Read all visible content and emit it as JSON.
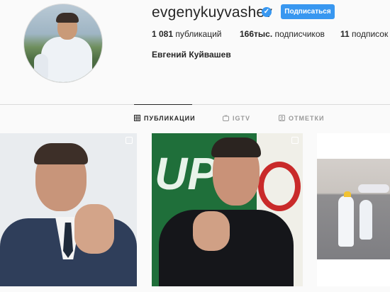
{
  "profile": {
    "username": "evgenykuyvashev",
    "follow_label": "Подписаться",
    "full_name": "Евгений Куйвашев",
    "verified_icon": "verified-badge-icon",
    "stats": {
      "posts_value": "1 081",
      "posts_label": "публикаций",
      "followers_value": "166тыс.",
      "followers_label": "подписчиков",
      "following_value": "11",
      "following_label": "подписок"
    }
  },
  "tabs": [
    {
      "label": "ПУБЛИКАЦИИ",
      "icon": "grid-icon",
      "active": true
    },
    {
      "label": "IGTV",
      "icon": "igtv-icon",
      "active": false
    },
    {
      "label": "ОТМЕТКИ",
      "icon": "tagged-icon",
      "active": false
    }
  ],
  "posts": [
    {
      "type": "image",
      "multiple": true
    },
    {
      "type": "image",
      "multiple": true
    },
    {
      "type": "image",
      "multiple": false
    }
  ],
  "colors": {
    "accent": "#3897f0",
    "text": "#262626",
    "muted": "#999999",
    "background": "#fafafa"
  }
}
